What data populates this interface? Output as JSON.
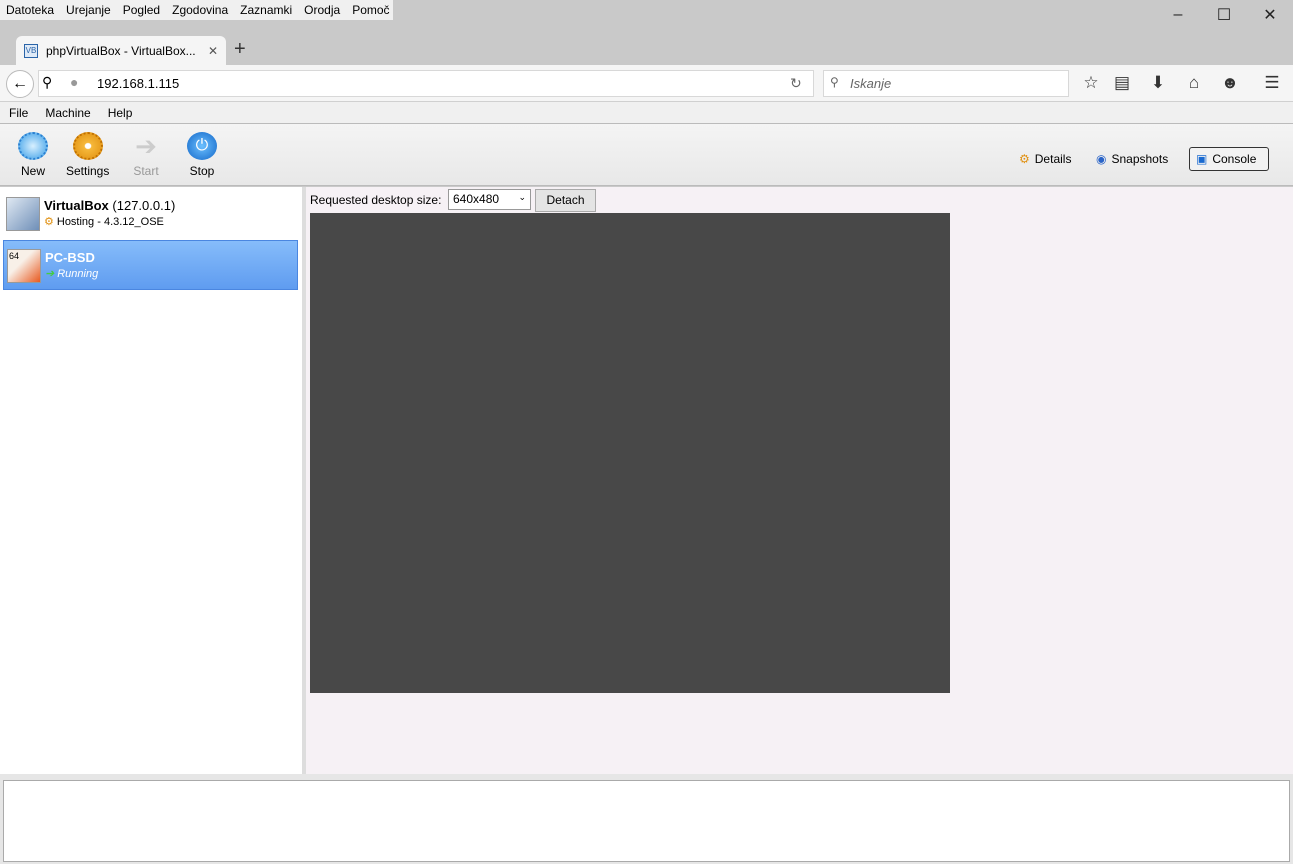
{
  "browser": {
    "menu": [
      "Datoteka",
      "Urejanje",
      "Pogled",
      "Zgodovina",
      "Zaznamki",
      "Orodja",
      "Pomoč"
    ],
    "tab_title": "phpVirtualBox - VirtualBox...",
    "url": "192.168.1.115",
    "search_placeholder": "Iskanje"
  },
  "app": {
    "menu": [
      "File",
      "Machine",
      "Help"
    ],
    "toolbar": {
      "new": "New",
      "settings": "Settings",
      "start": "Start",
      "stop": "Stop"
    },
    "view_tabs": {
      "details": "Details",
      "snapshots": "Snapshots",
      "console": "Console"
    },
    "host": {
      "name": "VirtualBox",
      "address": "(127.0.0.1)",
      "status": "Hosting - 4.3.12_OSE"
    },
    "vm": {
      "name": "PC-BSD",
      "state": "Running",
      "badge": "64"
    },
    "console": {
      "size_label": "Requested desktop size:",
      "size_value": "640x480",
      "detach": "Detach"
    }
  }
}
